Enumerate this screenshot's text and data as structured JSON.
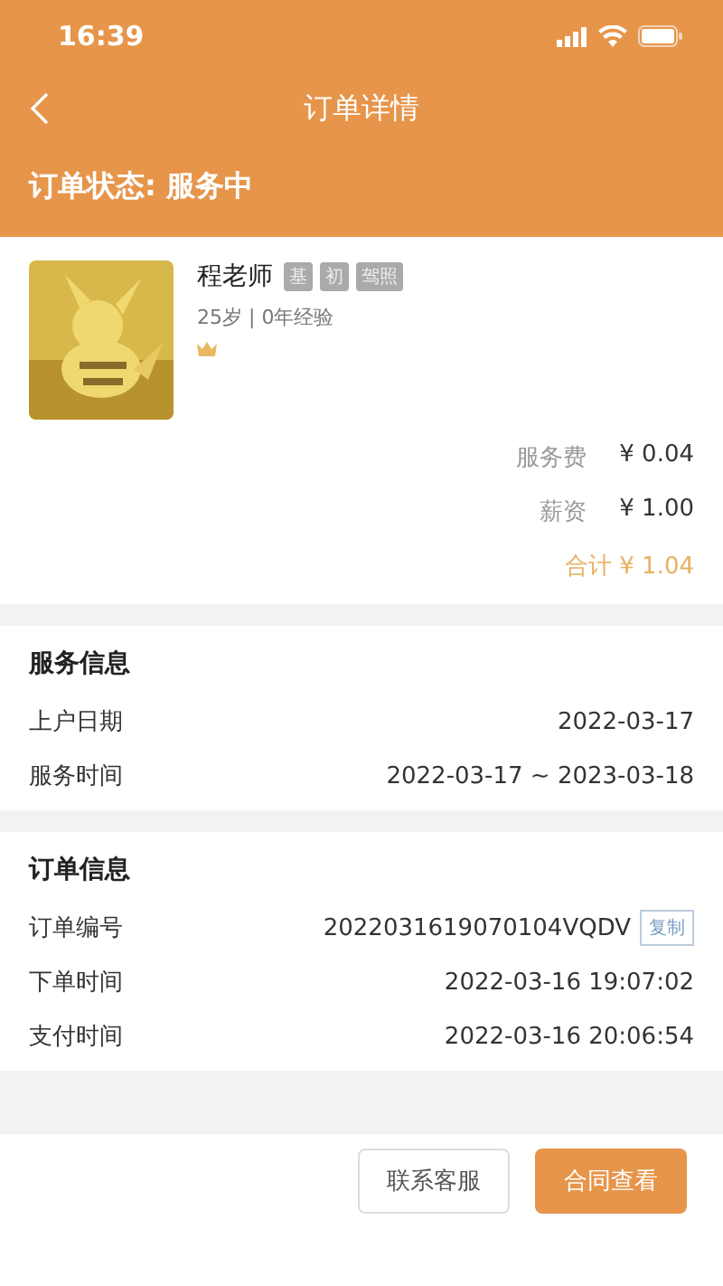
{
  "status_bar": {
    "time": "16:39"
  },
  "nav": {
    "title": "订单详情"
  },
  "order_status": "订单状态: 服务中",
  "teacher": {
    "name": "程老师",
    "tags": [
      "基",
      "初",
      "驾照"
    ],
    "meta": "25岁 | 0年经验"
  },
  "fees": [
    {
      "label": "服务费",
      "value": "¥ 0.04",
      "kind": "line"
    },
    {
      "label": "薪资",
      "value": "¥ 1.00",
      "kind": "line"
    },
    {
      "label": "合计 ¥ 1.04",
      "kind": "total"
    }
  ],
  "sections": [
    {
      "title": "服务信息",
      "rows": [
        {
          "label": "上户日期",
          "value": "2022-03-17"
        },
        {
          "label": "服务时间",
          "value": "2022-03-17 ~ 2023-03-18"
        }
      ]
    },
    {
      "title": "订单信息",
      "rows": [
        {
          "label": "订单编号",
          "value": "2022031619070104VQDV",
          "action": "复制"
        },
        {
          "label": "下单时间",
          "value": "2022-03-16 19:07:02"
        },
        {
          "label": "支付时间",
          "value": "2022-03-16 20:06:54"
        }
      ]
    }
  ],
  "buttons": [
    {
      "label": "联系客服",
      "kind": "outline"
    },
    {
      "label": "合同查看",
      "kind": "primary"
    }
  ]
}
